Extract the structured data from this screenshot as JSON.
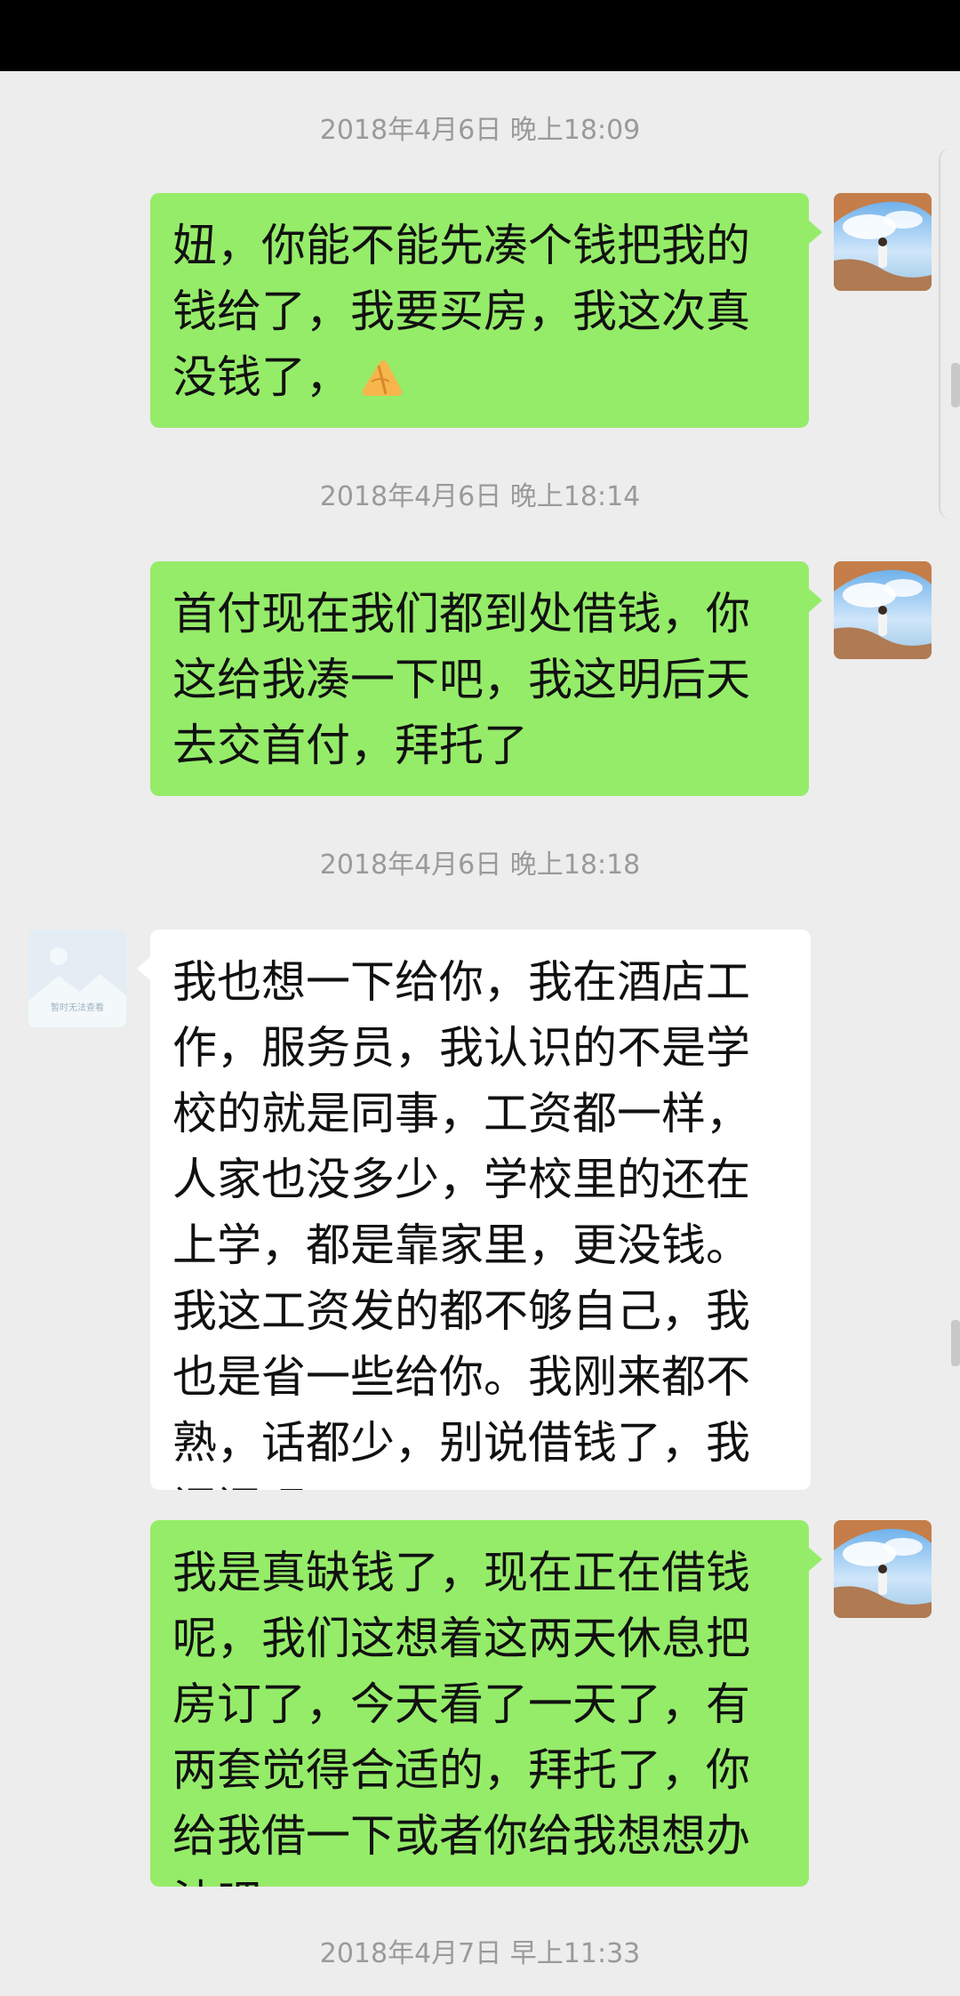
{
  "chat": {
    "timestamps": [
      "2018年4月6日 晚上18:09",
      "2018年4月6日 晚上18:14",
      "2018年4月6日 晚上18:18",
      "2018年4月7日 早上11:33"
    ],
    "messages": [
      {
        "direction": "outgoing",
        "text": "妞，你能不能先凑个钱把我的钱给了，我要买房，我这次真没钱了，",
        "emoji": "pray-hands-emoji"
      },
      {
        "direction": "outgoing",
        "text": "首付现在我们都到处借钱，你这给我凑一下吧，我这明后天去交首付，拜托了"
      },
      {
        "direction": "incoming",
        "text": "我也想一下给你，我在酒店工作，服务员，我认识的不是学校的就是同事，工资都一样，人家也没多少，学校里的还在上学，都是靠家里，更没钱。我这工资发的都不够自己，我也是省一些给你。我刚来都不熟，话都少，别说借钱了，我问问吧。"
      },
      {
        "direction": "outgoing",
        "text": "我是真缺钱了，现在正在借钱呢，我们这想着这两天休息把房订了，今天看了一天了，有两套觉得合适的，拜托了，你给我借一下或者你给我想想办法吧"
      }
    ],
    "placeholder_avatar_text": "暂时无法查看"
  },
  "colors": {
    "outgoing_bubble": "#95ec69",
    "incoming_bubble": "#ffffff",
    "background": "#ededed",
    "timestamp_text": "#9a9a9a"
  }
}
